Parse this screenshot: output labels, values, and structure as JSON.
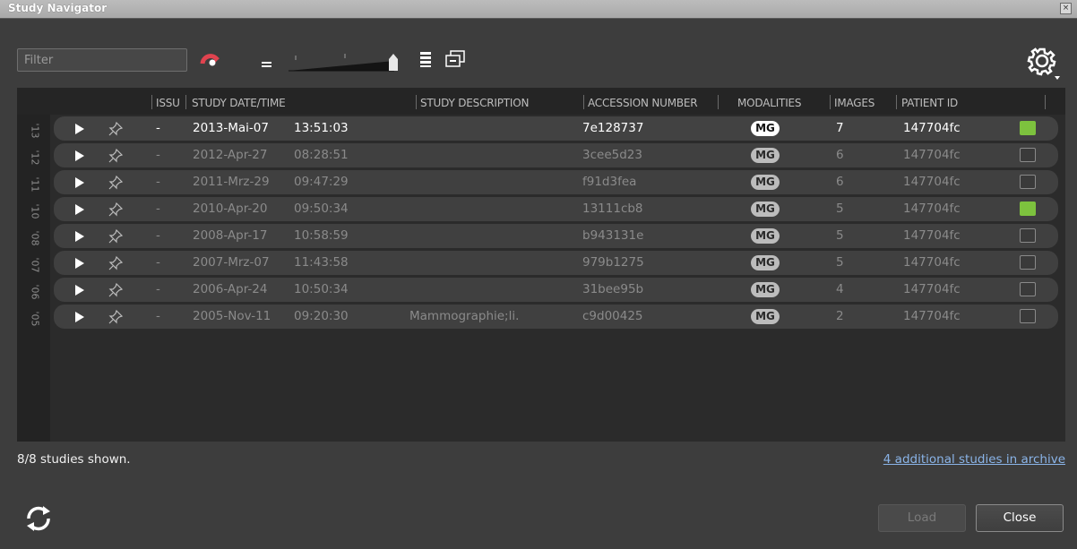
{
  "window": {
    "title": "Study Navigator",
    "close_glyph": "×"
  },
  "toolbar": {
    "filter_placeholder": "Filter",
    "icons": [
      "reset-filter-icon",
      "density-small-icon",
      "density-slider",
      "density-large-icon",
      "multi-window-icon",
      "gear-icon"
    ]
  },
  "table": {
    "headers": [
      "ISSU",
      "STUDY DATE/TIME",
      "STUDY DESCRIPTION",
      "ACCESSION NUMBER",
      "MODALITIES",
      "IMAGES",
      "PATIENT ID"
    ],
    "years": [
      "'13",
      "'12",
      "'11",
      "'10",
      "'08",
      "'07",
      "'06",
      "'05"
    ],
    "rows": [
      {
        "issue": "-",
        "date": "2013-Mai-07",
        "time": "13:51:03",
        "description": "",
        "accession": "7e128737",
        "modality": "MG",
        "images": "7",
        "patient_id": "147704fc",
        "checked": true,
        "selected": true
      },
      {
        "issue": "-",
        "date": "2012-Apr-27",
        "time": "08:28:51",
        "description": "",
        "accession": "3cee5d23",
        "modality": "MG",
        "images": "6",
        "patient_id": "147704fc",
        "checked": false,
        "selected": false
      },
      {
        "issue": "-",
        "date": "2011-Mrz-29",
        "time": "09:47:29",
        "description": "",
        "accession": "f91d3fea",
        "modality": "MG",
        "images": "6",
        "patient_id": "147704fc",
        "checked": false,
        "selected": false
      },
      {
        "issue": "-",
        "date": "2010-Apr-20",
        "time": "09:50:34",
        "description": "",
        "accession": "13111cb8",
        "modality": "MG",
        "images": "5",
        "patient_id": "147704fc",
        "checked": true,
        "selected": false
      },
      {
        "issue": "-",
        "date": "2008-Apr-17",
        "time": "10:58:59",
        "description": "",
        "accession": "b943131e",
        "modality": "MG",
        "images": "5",
        "patient_id": "147704fc",
        "checked": false,
        "selected": false
      },
      {
        "issue": "-",
        "date": "2007-Mrz-07",
        "time": "11:43:58",
        "description": "",
        "accession": "979b1275",
        "modality": "MG",
        "images": "5",
        "patient_id": "147704fc",
        "checked": false,
        "selected": false
      },
      {
        "issue": "-",
        "date": "2006-Apr-24",
        "time": "10:50:34",
        "description": "",
        "accession": "31bee95b",
        "modality": "MG",
        "images": "4",
        "patient_id": "147704fc",
        "checked": false,
        "selected": false
      },
      {
        "issue": "-",
        "date": "2005-Nov-11",
        "time": "09:20:30",
        "description": "Mammographie;li.",
        "accession": "c9d00425",
        "modality": "MG",
        "images": "2",
        "patient_id": "147704fc",
        "checked": false,
        "selected": false
      }
    ]
  },
  "footer": {
    "status": "8/8 studies shown.",
    "archive_link": "4 additional studies in archive",
    "load_label": "Load",
    "close_label": "Close"
  },
  "colors": {
    "checked_green": "#7dc23e",
    "reset_icon_red": "#e0434f",
    "link_blue": "#8ab4e8"
  }
}
